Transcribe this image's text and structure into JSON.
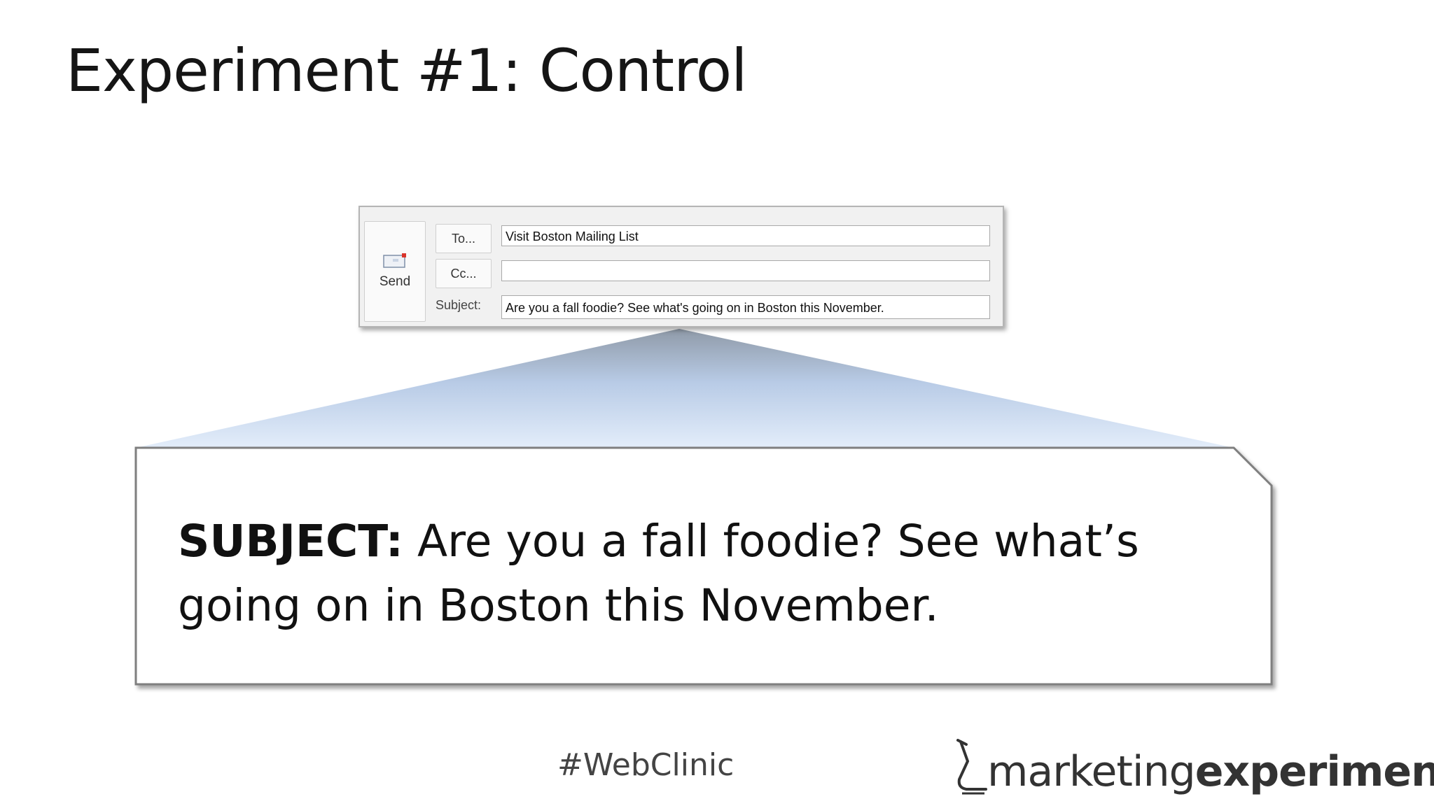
{
  "slide": {
    "title": "Experiment #1: Control",
    "hashtag": "#WebClinic"
  },
  "compose": {
    "send_label": "Send",
    "to_label": "To...",
    "cc_label": "Cc...",
    "subject_label": "Subject:",
    "to_value": "Visit Boston Mailing List",
    "cc_value": "",
    "subject_value": "Are you a fall foodie? See what's going on in Boston this November."
  },
  "callout": {
    "prefix": "SUBJECT:",
    "text": " Are you a fall foodie? See what’s going on in Boston this November."
  },
  "logo": {
    "part1": "marketing",
    "part2": "experiments"
  },
  "colors": {
    "callout_gradient_top": "#8f9aa8",
    "callout_gradient_bottom": "#dce8f8",
    "callout_border": "#7f7f7f"
  }
}
